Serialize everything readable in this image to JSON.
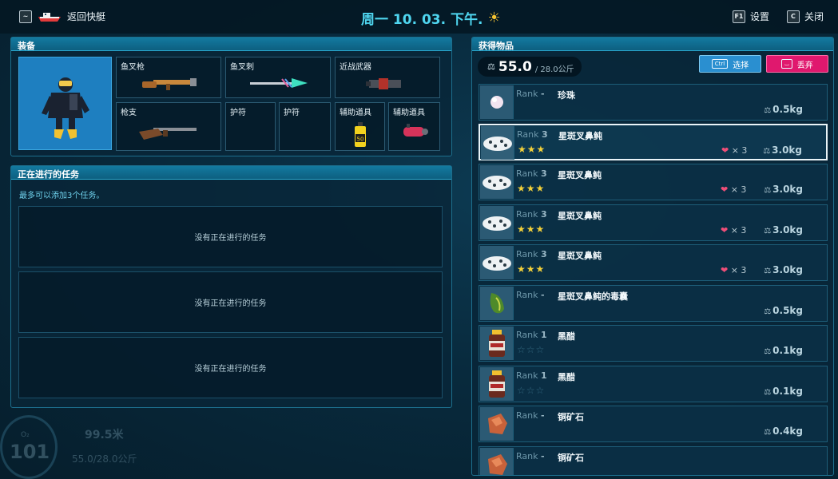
{
  "topbar": {
    "back_key": "~",
    "back_label": "返回快艇",
    "datetime": "周一 10. 03. 下午.",
    "weather_icon": "sun-icon",
    "settings_key": "F1",
    "settings_label": "设置",
    "close_key": "C",
    "close_label": "关闭"
  },
  "equipment": {
    "title": "装备",
    "slots": [
      {
        "label": "鱼叉枪",
        "icon": "harpoon-gun-icon"
      },
      {
        "label": "鱼叉刺",
        "icon": "harpoon-spear-icon"
      },
      {
        "label": "近战武器",
        "icon": "melee-weapon-icon"
      },
      {
        "label": "枪支",
        "icon": "rifle-icon"
      },
      {
        "label": "护符",
        "icon": ""
      },
      {
        "label": "护符",
        "icon": ""
      },
      {
        "label": "辅助道具",
        "icon": "oxygen-tank-icon",
        "badge": "50"
      },
      {
        "label": "辅助道具",
        "icon": "scooter-icon"
      }
    ]
  },
  "tasks": {
    "title": "正在进行的任务",
    "note": "最多可以添加3个任务。",
    "empty_slots": [
      "没有正在进行的任务",
      "没有正在进行的任务",
      "没有正在进行的任务"
    ]
  },
  "items_panel": {
    "title": "获得物品",
    "weight_current": "55.0",
    "weight_max": "/ 28.0公斤",
    "select_key": "Ctrl",
    "select_label": "选择",
    "drop_key": "⌴",
    "drop_label": "丢弃",
    "items": [
      {
        "rank": "Rank",
        "rank_value": "-",
        "name": "珍珠",
        "stars": 0,
        "show_stars": false,
        "qty": "",
        "weight": "0.5kg",
        "icon": "pearl-icon"
      },
      {
        "rank": "Rank",
        "rank_value": "3",
        "name": "星斑叉鼻鲀",
        "stars": 3,
        "show_stars": true,
        "qty": "× 3",
        "weight": "3.0kg",
        "icon": "pufferfish-icon",
        "selected": true
      },
      {
        "rank": "Rank",
        "rank_value": "3",
        "name": "星斑叉鼻鲀",
        "stars": 3,
        "show_stars": true,
        "qty": "× 3",
        "weight": "3.0kg",
        "icon": "pufferfish-icon"
      },
      {
        "rank": "Rank",
        "rank_value": "3",
        "name": "星斑叉鼻鲀",
        "stars": 3,
        "show_stars": true,
        "qty": "× 3",
        "weight": "3.0kg",
        "icon": "pufferfish-icon"
      },
      {
        "rank": "Rank",
        "rank_value": "3",
        "name": "星斑叉鼻鲀",
        "stars": 3,
        "show_stars": true,
        "qty": "× 3",
        "weight": "3.0kg",
        "icon": "pufferfish-icon"
      },
      {
        "rank": "Rank",
        "rank_value": "-",
        "name": "星斑叉鼻鲀的毒囊",
        "stars": 0,
        "show_stars": false,
        "qty": "",
        "weight": "0.5kg",
        "icon": "poison-sac-icon"
      },
      {
        "rank": "Rank",
        "rank_value": "1",
        "name": "黑醋",
        "stars": 0,
        "show_stars": true,
        "qty": "",
        "weight": "0.1kg",
        "icon": "vinegar-bottle-icon"
      },
      {
        "rank": "Rank",
        "rank_value": "1",
        "name": "黑醋",
        "stars": 0,
        "show_stars": true,
        "qty": "",
        "weight": "0.1kg",
        "icon": "vinegar-bottle-icon"
      },
      {
        "rank": "Rank",
        "rank_value": "-",
        "name": "铜矿石",
        "stars": 0,
        "show_stars": false,
        "qty": "",
        "weight": "0.4kg",
        "icon": "copper-ore-icon"
      },
      {
        "rank": "Rank",
        "rank_value": "-",
        "name": "铜矿石",
        "stars": 0,
        "show_stars": false,
        "qty": "",
        "weight": "",
        "icon": "copper-ore-icon"
      }
    ]
  },
  "hud": {
    "o2_label": "O₂",
    "o2_value": "101",
    "depth": "99.5米",
    "weight": "55.0/28.0公斤"
  },
  "colors": {
    "accent_cyan": "#4fd6f0",
    "select_blue": "#2a8fd0",
    "drop_pink": "#e0186e",
    "star_yellow": "#f4d13a"
  }
}
